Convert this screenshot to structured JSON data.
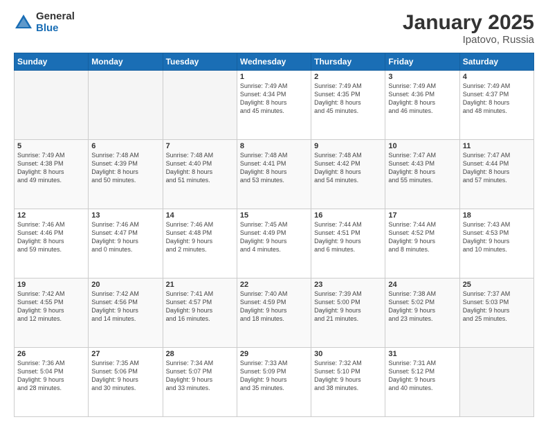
{
  "header": {
    "logo_general": "General",
    "logo_blue": "Blue",
    "main_title": "January 2025",
    "sub_title": "Ipatovo, Russia"
  },
  "days_of_week": [
    "Sunday",
    "Monday",
    "Tuesday",
    "Wednesday",
    "Thursday",
    "Friday",
    "Saturday"
  ],
  "weeks": [
    [
      {
        "day": "",
        "info": ""
      },
      {
        "day": "",
        "info": ""
      },
      {
        "day": "",
        "info": ""
      },
      {
        "day": "1",
        "info": "Sunrise: 7:49 AM\nSunset: 4:34 PM\nDaylight: 8 hours\nand 45 minutes."
      },
      {
        "day": "2",
        "info": "Sunrise: 7:49 AM\nSunset: 4:35 PM\nDaylight: 8 hours\nand 45 minutes."
      },
      {
        "day": "3",
        "info": "Sunrise: 7:49 AM\nSunset: 4:36 PM\nDaylight: 8 hours\nand 46 minutes."
      },
      {
        "day": "4",
        "info": "Sunrise: 7:49 AM\nSunset: 4:37 PM\nDaylight: 8 hours\nand 48 minutes."
      }
    ],
    [
      {
        "day": "5",
        "info": "Sunrise: 7:49 AM\nSunset: 4:38 PM\nDaylight: 8 hours\nand 49 minutes."
      },
      {
        "day": "6",
        "info": "Sunrise: 7:48 AM\nSunset: 4:39 PM\nDaylight: 8 hours\nand 50 minutes."
      },
      {
        "day": "7",
        "info": "Sunrise: 7:48 AM\nSunset: 4:40 PM\nDaylight: 8 hours\nand 51 minutes."
      },
      {
        "day": "8",
        "info": "Sunrise: 7:48 AM\nSunset: 4:41 PM\nDaylight: 8 hours\nand 53 minutes."
      },
      {
        "day": "9",
        "info": "Sunrise: 7:48 AM\nSunset: 4:42 PM\nDaylight: 8 hours\nand 54 minutes."
      },
      {
        "day": "10",
        "info": "Sunrise: 7:47 AM\nSunset: 4:43 PM\nDaylight: 8 hours\nand 55 minutes."
      },
      {
        "day": "11",
        "info": "Sunrise: 7:47 AM\nSunset: 4:44 PM\nDaylight: 8 hours\nand 57 minutes."
      }
    ],
    [
      {
        "day": "12",
        "info": "Sunrise: 7:46 AM\nSunset: 4:46 PM\nDaylight: 8 hours\nand 59 minutes."
      },
      {
        "day": "13",
        "info": "Sunrise: 7:46 AM\nSunset: 4:47 PM\nDaylight: 9 hours\nand 0 minutes."
      },
      {
        "day": "14",
        "info": "Sunrise: 7:46 AM\nSunset: 4:48 PM\nDaylight: 9 hours\nand 2 minutes."
      },
      {
        "day": "15",
        "info": "Sunrise: 7:45 AM\nSunset: 4:49 PM\nDaylight: 9 hours\nand 4 minutes."
      },
      {
        "day": "16",
        "info": "Sunrise: 7:44 AM\nSunset: 4:51 PM\nDaylight: 9 hours\nand 6 minutes."
      },
      {
        "day": "17",
        "info": "Sunrise: 7:44 AM\nSunset: 4:52 PM\nDaylight: 9 hours\nand 8 minutes."
      },
      {
        "day": "18",
        "info": "Sunrise: 7:43 AM\nSunset: 4:53 PM\nDaylight: 9 hours\nand 10 minutes."
      }
    ],
    [
      {
        "day": "19",
        "info": "Sunrise: 7:42 AM\nSunset: 4:55 PM\nDaylight: 9 hours\nand 12 minutes."
      },
      {
        "day": "20",
        "info": "Sunrise: 7:42 AM\nSunset: 4:56 PM\nDaylight: 9 hours\nand 14 minutes."
      },
      {
        "day": "21",
        "info": "Sunrise: 7:41 AM\nSunset: 4:57 PM\nDaylight: 9 hours\nand 16 minutes."
      },
      {
        "day": "22",
        "info": "Sunrise: 7:40 AM\nSunset: 4:59 PM\nDaylight: 9 hours\nand 18 minutes."
      },
      {
        "day": "23",
        "info": "Sunrise: 7:39 AM\nSunset: 5:00 PM\nDaylight: 9 hours\nand 21 minutes."
      },
      {
        "day": "24",
        "info": "Sunrise: 7:38 AM\nSunset: 5:02 PM\nDaylight: 9 hours\nand 23 minutes."
      },
      {
        "day": "25",
        "info": "Sunrise: 7:37 AM\nSunset: 5:03 PM\nDaylight: 9 hours\nand 25 minutes."
      }
    ],
    [
      {
        "day": "26",
        "info": "Sunrise: 7:36 AM\nSunset: 5:04 PM\nDaylight: 9 hours\nand 28 minutes."
      },
      {
        "day": "27",
        "info": "Sunrise: 7:35 AM\nSunset: 5:06 PM\nDaylight: 9 hours\nand 30 minutes."
      },
      {
        "day": "28",
        "info": "Sunrise: 7:34 AM\nSunset: 5:07 PM\nDaylight: 9 hours\nand 33 minutes."
      },
      {
        "day": "29",
        "info": "Sunrise: 7:33 AM\nSunset: 5:09 PM\nDaylight: 9 hours\nand 35 minutes."
      },
      {
        "day": "30",
        "info": "Sunrise: 7:32 AM\nSunset: 5:10 PM\nDaylight: 9 hours\nand 38 minutes."
      },
      {
        "day": "31",
        "info": "Sunrise: 7:31 AM\nSunset: 5:12 PM\nDaylight: 9 hours\nand 40 minutes."
      },
      {
        "day": "",
        "info": ""
      }
    ]
  ]
}
